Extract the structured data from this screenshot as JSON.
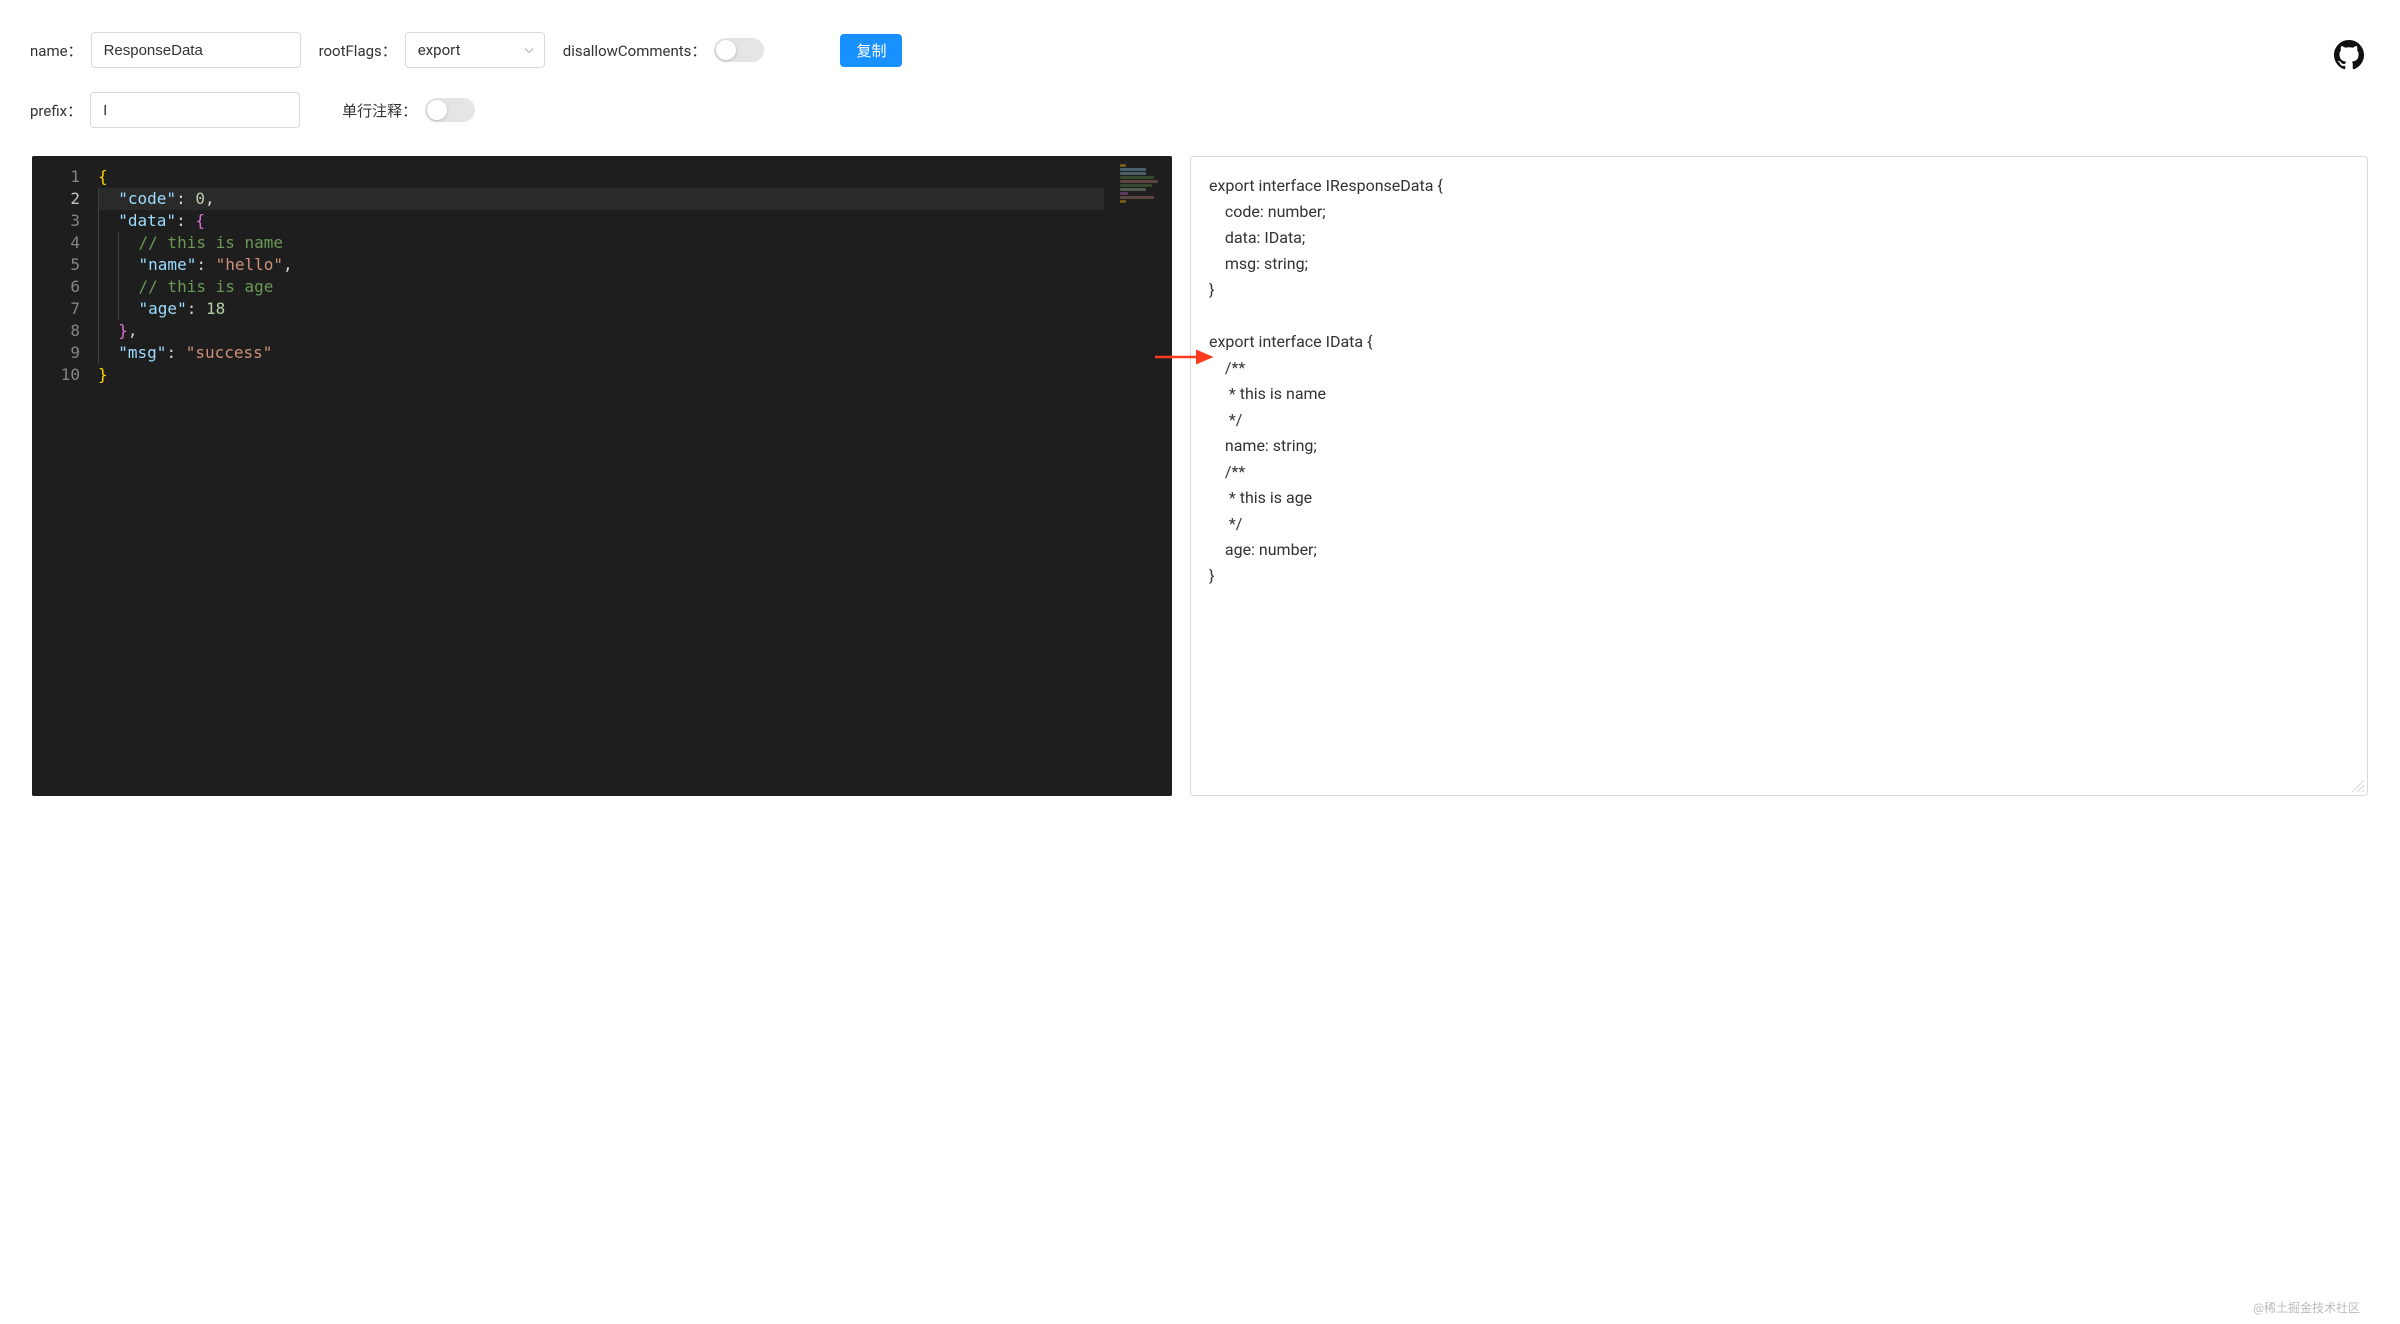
{
  "toolbar": {
    "name_label": "name：",
    "name_value": "ResponseData",
    "rootflags_label": "rootFlags：",
    "rootflags_value": "export",
    "disallow_label": "disallowComments：",
    "disallow_on": false,
    "copy_label": "复制",
    "prefix_label": "prefix：",
    "prefix_value": "I",
    "singleline_label": "单行注释：",
    "singleline_on": false
  },
  "editor": {
    "highlighted_line": 2,
    "lines": [
      {
        "n": 1,
        "indent": 0,
        "tokens": [
          {
            "t": "{",
            "c": "brace"
          }
        ]
      },
      {
        "n": 2,
        "indent": 1,
        "tokens": [
          {
            "t": "\"code\"",
            "c": "key"
          },
          {
            "t": ": ",
            "c": "punc"
          },
          {
            "t": "0",
            "c": "num"
          },
          {
            "t": ",",
            "c": "punc"
          }
        ]
      },
      {
        "n": 3,
        "indent": 1,
        "tokens": [
          {
            "t": "\"data\"",
            "c": "key"
          },
          {
            "t": ": ",
            "c": "punc"
          },
          {
            "t": "{",
            "c": "brace2"
          }
        ]
      },
      {
        "n": 4,
        "indent": 2,
        "tokens": [
          {
            "t": "// this is name",
            "c": "comment"
          }
        ]
      },
      {
        "n": 5,
        "indent": 2,
        "tokens": [
          {
            "t": "\"name\"",
            "c": "key"
          },
          {
            "t": ": ",
            "c": "punc"
          },
          {
            "t": "\"hello\"",
            "c": "str"
          },
          {
            "t": ",",
            "c": "punc"
          }
        ]
      },
      {
        "n": 6,
        "indent": 2,
        "tokens": [
          {
            "t": "// this is age",
            "c": "comment"
          }
        ]
      },
      {
        "n": 7,
        "indent": 2,
        "tokens": [
          {
            "t": "\"age\"",
            "c": "key"
          },
          {
            "t": ": ",
            "c": "punc"
          },
          {
            "t": "18",
            "c": "num"
          }
        ]
      },
      {
        "n": 8,
        "indent": 1,
        "tokens": [
          {
            "t": "}",
            "c": "brace2"
          },
          {
            "t": ",",
            "c": "punc"
          }
        ]
      },
      {
        "n": 9,
        "indent": 1,
        "tokens": [
          {
            "t": "\"msg\"",
            "c": "key"
          },
          {
            "t": ": ",
            "c": "punc"
          },
          {
            "t": "\"success\"",
            "c": "str"
          }
        ]
      },
      {
        "n": 10,
        "indent": 0,
        "tokens": [
          {
            "t": "}",
            "c": "brace"
          }
        ]
      }
    ]
  },
  "output": "export interface IResponseData {\n    code: number;\n    data: IData;\n    msg: string;\n}\n\nexport interface IData {\n    /**\n     * this is name\n     */\n    name: string;\n    /**\n     * this is age\n     */\n    age: number;\n}",
  "watermark": "@稀土掘金技术社区",
  "colors": {
    "primary": "#1890ff",
    "editor_bg": "#1e1e1e"
  }
}
